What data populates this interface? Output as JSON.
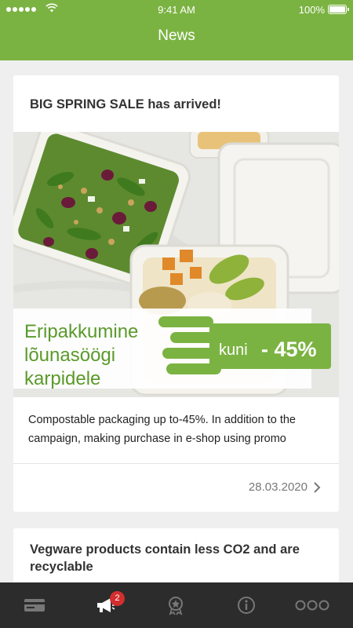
{
  "status_bar": {
    "time": "9:41 AM",
    "battery": "100%"
  },
  "header": {
    "title": "News"
  },
  "articles": [
    {
      "title": "BIG SPRING SALE has arrived!",
      "image_text": {
        "line1": "Eripakkumine",
        "line2": "lõunasöögi",
        "line3": "karpidele",
        "kuni": "kuni",
        "discount": "- 45%"
      },
      "excerpt": "Compostable packaging up to-45%. In addition to the campaign, making purchase in e-shop using promo",
      "date": "28.03.2020"
    },
    {
      "title": "Vegware products contain less CO2 and are recyclable"
    }
  ],
  "tabbar": {
    "items": [
      "card-icon",
      "megaphone-icon",
      "award-icon",
      "info-icon",
      "more-icon"
    ],
    "badge": "2"
  },
  "colors": {
    "brand_green": "#7bb342",
    "tabbar": "#2c2c2c",
    "badge": "#d32f2f"
  }
}
